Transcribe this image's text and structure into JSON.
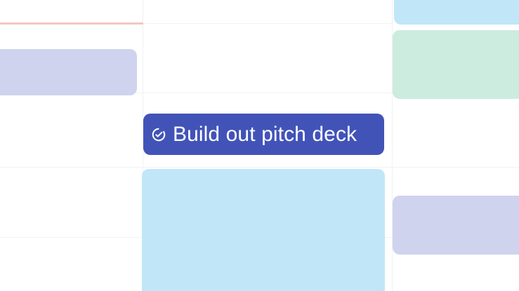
{
  "calendar": {
    "colors": {
      "background": "#ffffff",
      "grid": "#f1f2f4",
      "now_line": "#f3c7c2",
      "lavender": "#d0d3ee",
      "light_blue": "#c1e6f8",
      "mint": "#ccecdf",
      "task_chip": "#4253b8",
      "task_text": "#ffffff"
    },
    "task_chip": {
      "label": "Build out pitch deck",
      "icon": "check-circle-icon"
    }
  }
}
